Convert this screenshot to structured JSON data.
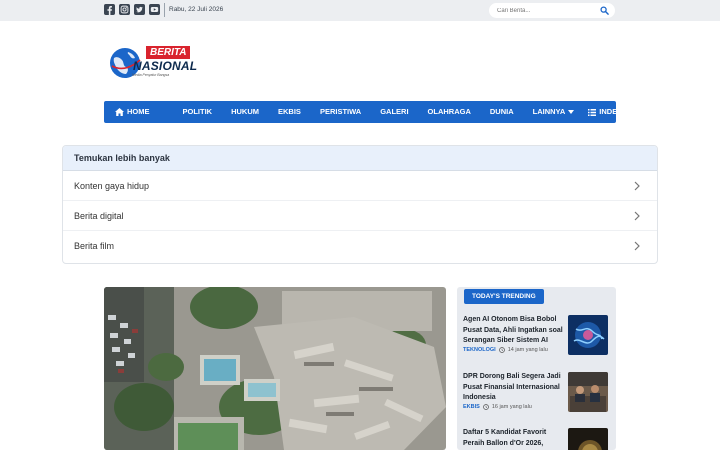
{
  "topbar": {
    "social": [
      "facebook-icon",
      "instagram-icon",
      "twitter-icon",
      "youtube-icon"
    ],
    "date": "Rabu, 22 Juli 2026",
    "search_placeholder": "Cari Berita..."
  },
  "logo": {
    "word1": "BERITA",
    "word2": "NASIONAL",
    "tagline": "Media Penyalur Bangsa"
  },
  "nav": {
    "home": "HOME",
    "items": [
      "POLITIK",
      "HUKUM",
      "EKBIS",
      "PERISTIWA",
      "GALERI",
      "OLAHRAGA",
      "DUNIA",
      "LAINNYA"
    ],
    "index": "INDEKS"
  },
  "discover": {
    "heading": "Temukan lebih banyak",
    "rows": [
      "Konten gaya hidup",
      "Berita digital",
      "Berita film"
    ]
  },
  "trending": {
    "badge": "TODAY'S TRENDING",
    "items": [
      {
        "title": "Agen AI Otonom Bisa Bobol Pusat Data, Ahli Ingatkan soal Serangan Siber Sistem AI",
        "category": "TEKNOLOGI",
        "time": "14 jam yang lalu"
      },
      {
        "title": "DPR Dorong Bali Segera Jadi Pusat Finansial Internasional Indonesia",
        "category": "EKBIS",
        "time": "16 jam yang lalu"
      },
      {
        "title": "Daftar 5 Kandidat Favorit Peraih Ballon d'Or 2026,",
        "category": "",
        "time": ""
      }
    ]
  },
  "colors": {
    "nav_blue": "#1b66c9",
    "logo_red": "#d9232d",
    "topbar_bg": "#eceef1"
  }
}
